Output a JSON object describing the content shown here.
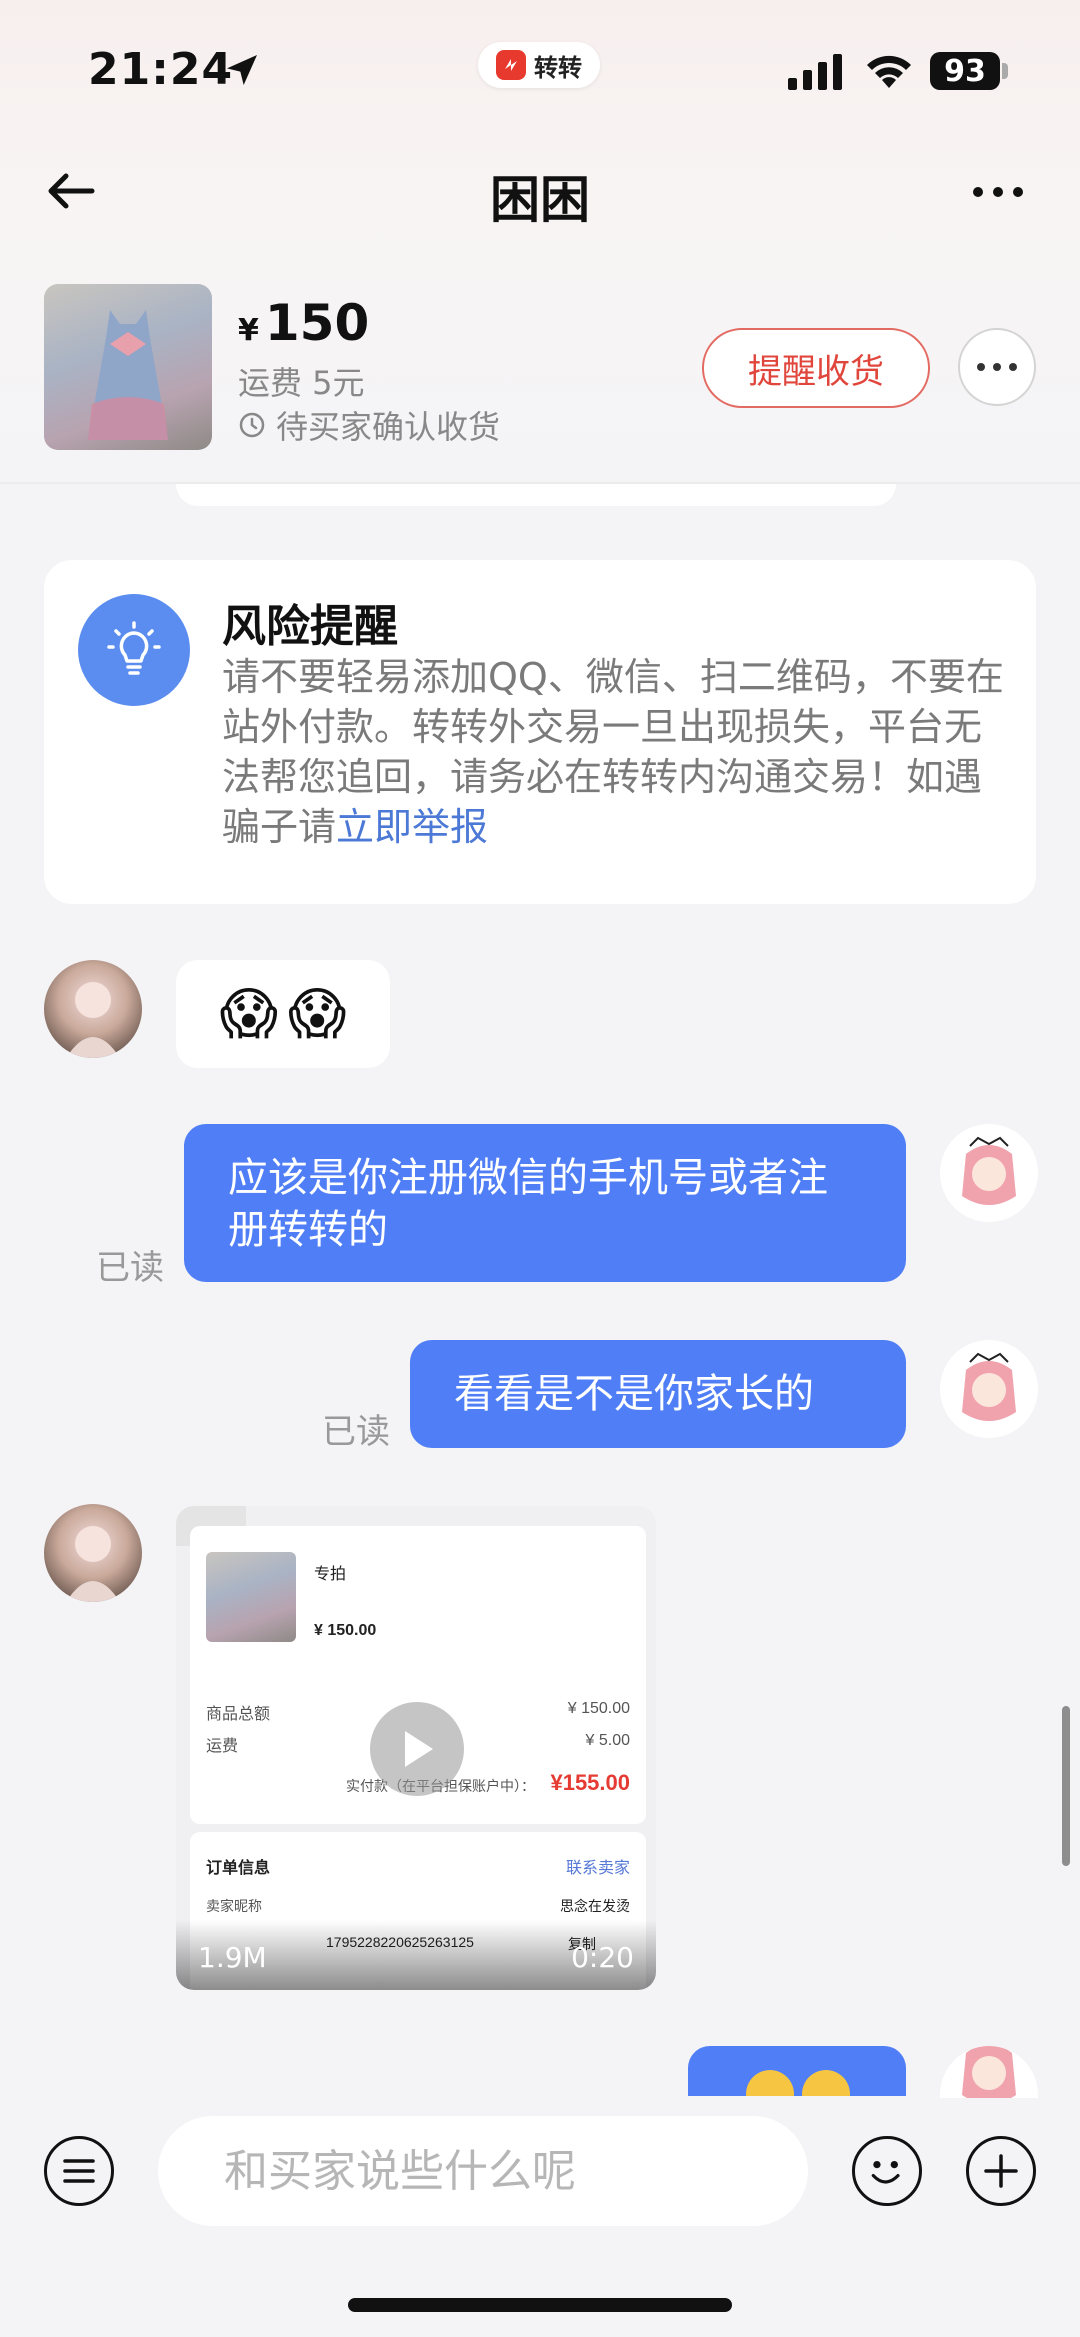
{
  "status_bar": {
    "time": "21:24",
    "app_label": "转转",
    "battery": "93"
  },
  "header": {
    "title": "困困"
  },
  "product": {
    "currency": "¥",
    "price": "150",
    "shipping": "运费 5元",
    "status": "待买家确认收货",
    "remind_button": "提醒收货"
  },
  "risk": {
    "title": "风险提醒",
    "body": "请不要轻易添加QQ、微信、扫二维码，不要在站外付款。转转外交易一旦出现损失，平台无法帮您追回，请务必在转转内沟通交易！如遇骗子请",
    "link": "立即举报"
  },
  "messages": {
    "m1_emoji": [
      "😱",
      "😱"
    ],
    "m2_text": "应该是你注册微信的手机号或者注册转转的",
    "m2_read": "已读",
    "m3_text": "看看是不是你家长的",
    "m3_read": "已读"
  },
  "video": {
    "item_name": "专拍",
    "item_price": "¥ 150.00",
    "total_label": "商品总额",
    "total_value": "¥ 150.00",
    "shipping_label": "运费",
    "shipping_value": "¥ 5.00",
    "paid_label": "实付款（在平台担保账户中）：",
    "paid_value": "¥155.00",
    "order_info": "订单信息",
    "contact_seller": "联系卖家",
    "seller_nick_label": "卖家昵称",
    "seller_nick": "思念在发烫",
    "order_no": "1795228220625263125",
    "copy": "复制",
    "size": "1.9M",
    "duration": "0:20"
  },
  "input": {
    "placeholder": "和买家说些什么呢"
  },
  "colors": {
    "accent_blue": "#4f7ef6",
    "remind_red": "#e0463c",
    "risk_icon_blue": "#5b8df0"
  }
}
